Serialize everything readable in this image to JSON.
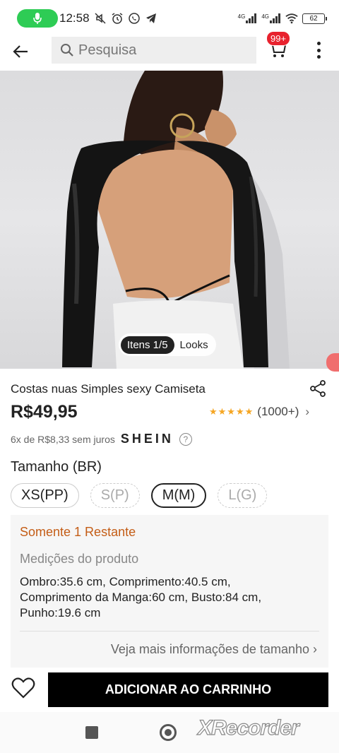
{
  "status_bar": {
    "time": "12:58",
    "network_1": "4G",
    "network_2": "4G",
    "battery": "62"
  },
  "header": {
    "search_placeholder": "Pesquisa",
    "cart_badge": "99+"
  },
  "gallery": {
    "active_tab": "Itens 1/5",
    "other_tab": "Looks"
  },
  "product": {
    "title": "Costas nuas Simples sexy Camiseta",
    "price": "R$49,95",
    "rating_stars": 5,
    "rating_count": "(1000+)",
    "installments": "6x de R$8,33 sem juros",
    "brand": "SHEIN"
  },
  "size": {
    "heading": "Tamanho (BR)",
    "options": [
      {
        "label": "XS(PP)",
        "state": "available"
      },
      {
        "label": "S(P)",
        "state": "out"
      },
      {
        "label": "M(M)",
        "state": "selected"
      },
      {
        "label": "L(G)",
        "state": "out"
      }
    ],
    "remaining": "Somente 1 Restante",
    "measurements_title": "Medições do produto",
    "measurements": [
      {
        "label": "Ombro:",
        "value": "35.6 cm"
      },
      {
        "label": "Comprimento:",
        "value": "40.5 cm"
      },
      {
        "label": "Comprimento da Manga:",
        "value": "60 cm"
      },
      {
        "label": "Busto:",
        "value": "84 cm"
      },
      {
        "label": "Punho:",
        "value": "19.6 cm"
      }
    ],
    "more_info": "Veja mais informações de tamanho"
  },
  "actions": {
    "add_to_cart": "ADICIONAR AO CARRINHO"
  },
  "watermark": "XRecorder",
  "colors": {
    "accent_red": "#e8222e",
    "remaining_orange": "#c45d16",
    "star": "#f5a623",
    "recording_green": "#2ecc55"
  }
}
